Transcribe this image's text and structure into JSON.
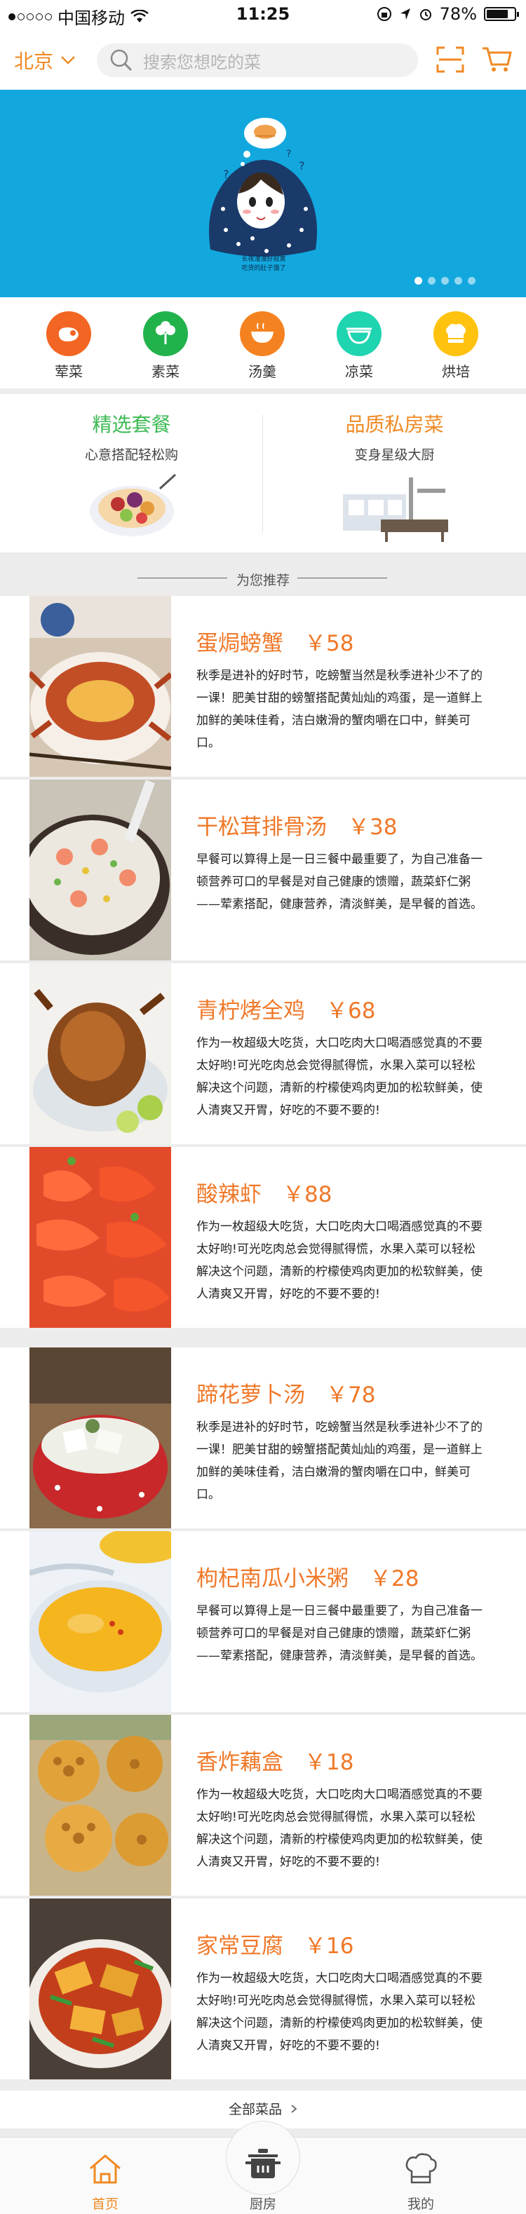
{
  "colors": {
    "accent": "#f08a24",
    "banner": "#12a8de",
    "green": "#3cba54"
  },
  "status_bar": {
    "signal_dots": 5,
    "carrier": "中国移动",
    "time": "11:25",
    "battery": "78%",
    "battery_level": 0.78
  },
  "nav": {
    "city": "北京",
    "search_placeholder": "搜索您想吃的菜",
    "scan_icon": "scan-icon",
    "cart_icon": "cart-icon"
  },
  "banner": {
    "caption_line1": "长夜漫漫好寂寞",
    "caption_line2": "吃货的肚子饿了",
    "page_count": 5,
    "active_page": 1
  },
  "categories": [
    {
      "label": "荤菜",
      "icon": "meat-icon",
      "color": "#f26522"
    },
    {
      "label": "素菜",
      "icon": "vegetable-icon",
      "color": "#22b24c"
    },
    {
      "label": "汤羹",
      "icon": "soup-icon",
      "color": "#f58220"
    },
    {
      "label": "凉菜",
      "icon": "cold-dish-icon",
      "color": "#1fd4b0"
    },
    {
      "label": "烘培",
      "icon": "baking-icon",
      "color": "#ffc20e"
    }
  ],
  "promos": [
    {
      "title": "精选套餐",
      "subtitle": "心意搭配轻松购",
      "color": "#3cba54"
    },
    {
      "title": "品质私房菜",
      "subtitle": "变身星级大厨",
      "color": "#f08a24"
    }
  ],
  "recommend_title": "为您推荐",
  "dishes": [
    {
      "name": "蛋焗螃蟹",
      "price": "￥58",
      "desc": "秋季是进补的好时节，吃螃蟹当然是秋季进补少不了的一课！肥美甘甜的螃蟹搭配黄灿灿的鸡蛋，是一道鲜上加鲜的美味佳肴，洁白嫩滑的蟹肉嚼在口中，鲜美可口。"
    },
    {
      "name": "干松茸排骨汤",
      "price": "￥38",
      "desc": "早餐可以算得上是一日三餐中最重要了，为自己准备一顿营养可口的早餐是对自己健康的馈赠，蔬菜虾仁粥——荤素搭配，健康营养，清淡鲜美，是早餐的首选。"
    },
    {
      "name": "青柠烤全鸡",
      "price": "￥68",
      "desc": "作为一枚超级大吃货，大口吃肉大口喝酒感觉真的不要太好哟!可光吃肉总会觉得腻得慌，水果入菜可以轻松解决这个问题，清新的柠檬使鸡肉更加的松软鲜美，使人清爽又开胃，好吃的不要不要的!"
    },
    {
      "name": "酸辣虾",
      "price": "￥88",
      "desc": "作为一枚超级大吃货，大口吃肉大口喝酒感觉真的不要太好哟!可光吃肉总会觉得腻得慌，水果入菜可以轻松解决这个问题，清新的柠檬使鸡肉更加的松软鲜美，使人清爽又开胃，好吃的不要不要的!"
    },
    {
      "name": "蹄花萝卜汤",
      "price": "￥78",
      "desc": "秋季是进补的好时节，吃螃蟹当然是秋季进补少不了的一课！肥美甘甜的螃蟹搭配黄灿灿的鸡蛋，是一道鲜上加鲜的美味佳肴，洁白嫩滑的蟹肉嚼在口中，鲜美可口。"
    },
    {
      "name": "枸杞南瓜小米粥",
      "price": "￥28",
      "desc": "早餐可以算得上是一日三餐中最重要了，为自己准备一顿营养可口的早餐是对自己健康的馈赠，蔬菜虾仁粥——荤素搭配，健康营养，清淡鲜美，是早餐的首选。"
    },
    {
      "name": "香炸藕盒",
      "price": "￥18",
      "desc": "作为一枚超级大吃货，大口吃肉大口喝酒感觉真的不要太好哟!可光吃肉总会觉得腻得慌，水果入菜可以轻松解决这个问题，清新的柠檬使鸡肉更加的松软鲜美，使人清爽又开胃，好吃的不要不要的!"
    },
    {
      "name": "家常豆腐",
      "price": "￥16",
      "desc": "作为一枚超级大吃货，大口吃肉大口喝酒感觉真的不要太好哟!可光吃肉总会觉得腻得慌，水果入菜可以轻松解决这个问题，清新的柠檬使鸡肉更加的松软鲜美，使人清爽又开胃，好吃的不要不要的!"
    }
  ],
  "all_dishes_link": "全部菜品",
  "tabbar": [
    {
      "label": "首页",
      "icon": "home-icon",
      "active": true
    },
    {
      "label": "厨房",
      "icon": "kitchen-pot-icon",
      "active": false
    },
    {
      "label": "我的",
      "icon": "chef-hat-icon",
      "active": false
    }
  ]
}
